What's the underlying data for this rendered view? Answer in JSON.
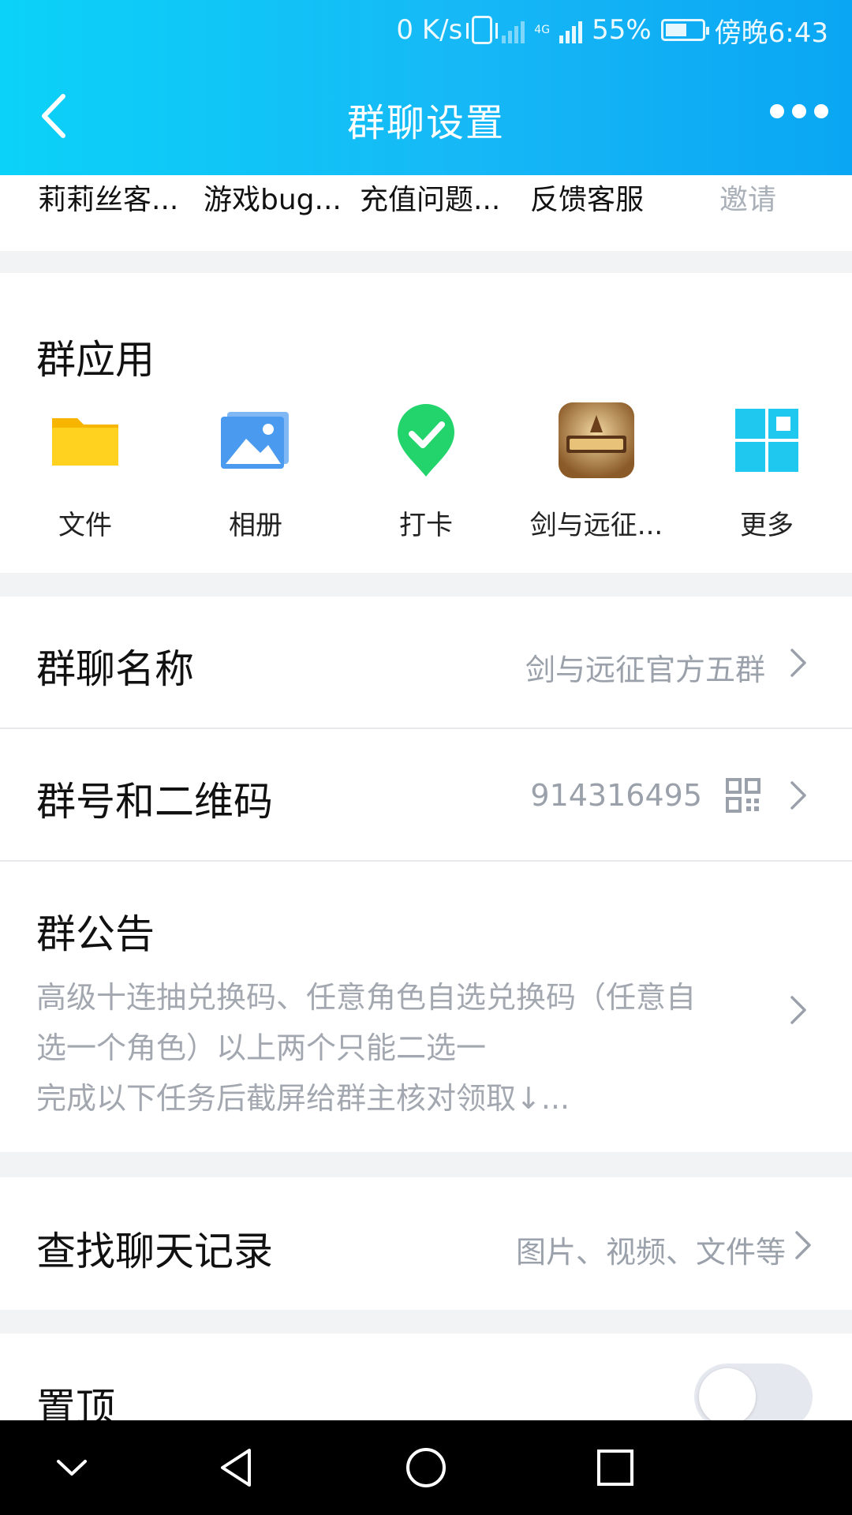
{
  "status_bar": {
    "net_speed": "0 K/s",
    "network_type": "4G",
    "battery": "55%",
    "time": "傍晚6:43"
  },
  "header": {
    "title": "群聊设置",
    "back_icon": "chevron-left-icon",
    "more_icon": "more-horizontal-icon"
  },
  "members": {
    "names": [
      "莉莉丝客...",
      "游戏bug...",
      "充值问题...",
      "反馈客服"
    ],
    "invite_label": "邀请"
  },
  "group_apps": {
    "title": "群应用",
    "items": [
      {
        "label": "文件",
        "icon": "folder-icon"
      },
      {
        "label": "相册",
        "icon": "photo-album-icon"
      },
      {
        "label": "打卡",
        "icon": "checkin-pin-icon"
      },
      {
        "label": "剑与远征...",
        "icon": "game-app-icon"
      },
      {
        "label": "更多",
        "icon": "grid-more-icon"
      }
    ]
  },
  "settings": {
    "group_name": {
      "label": "群聊名称",
      "value": "剑与远征官方五群"
    },
    "group_id": {
      "label": "群号和二维码",
      "value": "914316495"
    },
    "notice": {
      "label": "群公告",
      "lines": [
        "高级十连抽兑换码、任意角色自选兑换码（任意自",
        "选一个角色）以上两个只能二选一",
        "完成以下任务后截屏给群主核对领取↓..."
      ]
    },
    "search_history": {
      "label": "查找聊天记录",
      "value": "图片、视频、文件等"
    },
    "pin": {
      "label": "置顶",
      "enabled": false
    }
  },
  "colors": {
    "header_start": "#0bd2f8",
    "header_end": "#0aa6f3",
    "secondary_text": "#9aa1aa",
    "checkin_green": "#22d46b",
    "more_blue": "#1ec8ee"
  }
}
